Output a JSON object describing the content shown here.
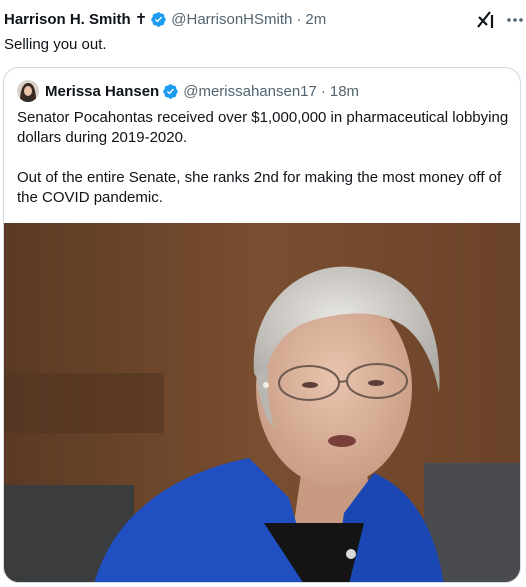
{
  "post": {
    "author_name": "Harrison H. Smith",
    "author_badge_glyph": "✝",
    "handle": "@HarrisonHSmith",
    "separator": "·",
    "time": "2m",
    "text": "Selling you out.",
    "icons": [
      "cross-icon",
      "verified-icon",
      "grok-icon",
      "more-icon"
    ]
  },
  "quote": {
    "author_name": "Merissa Hansen",
    "handle": "@merissahansen17",
    "separator": "·",
    "time": "18m",
    "paragraph_1": "Senator Pocahontas received over $1,000,000 in pharmaceutical lobbying dollars during 2019-2020.",
    "paragraph_2": "Out of the entire Senate, she ranks 2nd for making the most money off of the COVID pandemic.",
    "media": "photo-of-senator-speaking"
  },
  "colors": {
    "text": "#0f1419",
    "secondary": "#536471",
    "verified": "#1d9bf0",
    "border": "#cfd9de"
  }
}
